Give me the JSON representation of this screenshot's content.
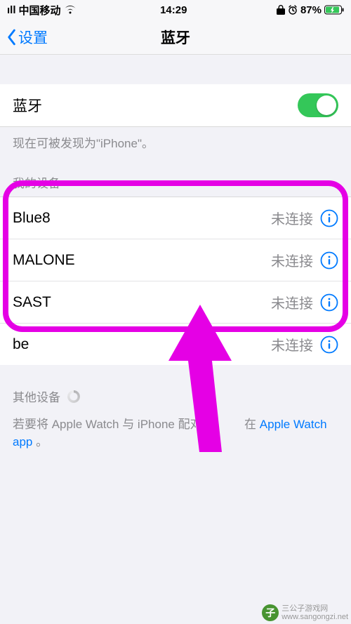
{
  "status": {
    "signal_text": "ıll",
    "carrier": "中国移动",
    "time": "14:29",
    "battery_pct": "87%"
  },
  "nav": {
    "back_label": "设置",
    "title": "蓝牙"
  },
  "main": {
    "bluetooth_label": "蓝牙",
    "bluetooth_on": true,
    "discoverable_text": "现在可被发现为\"iPhone\"。"
  },
  "my_devices": {
    "header": "我的设备",
    "status_not_connected": "未连接",
    "items": [
      {
        "name": "Blue8",
        "status": "未连接"
      },
      {
        "name": "MALONE",
        "status": "未连接"
      },
      {
        "name": "SAST",
        "status": "未连接"
      },
      {
        "name": "be",
        "status": "未连接"
      }
    ]
  },
  "other_devices": {
    "header": "其他设备",
    "pairing_prefix": "若要将 Apple Watch 与 iPhone 配对",
    "pairing_mid": "在",
    "pairing_link": "Apple Watch app",
    "pairing_suffix": "。"
  },
  "watermark": {
    "title": "三公子游戏网",
    "url": "www.sangongzi.net"
  }
}
